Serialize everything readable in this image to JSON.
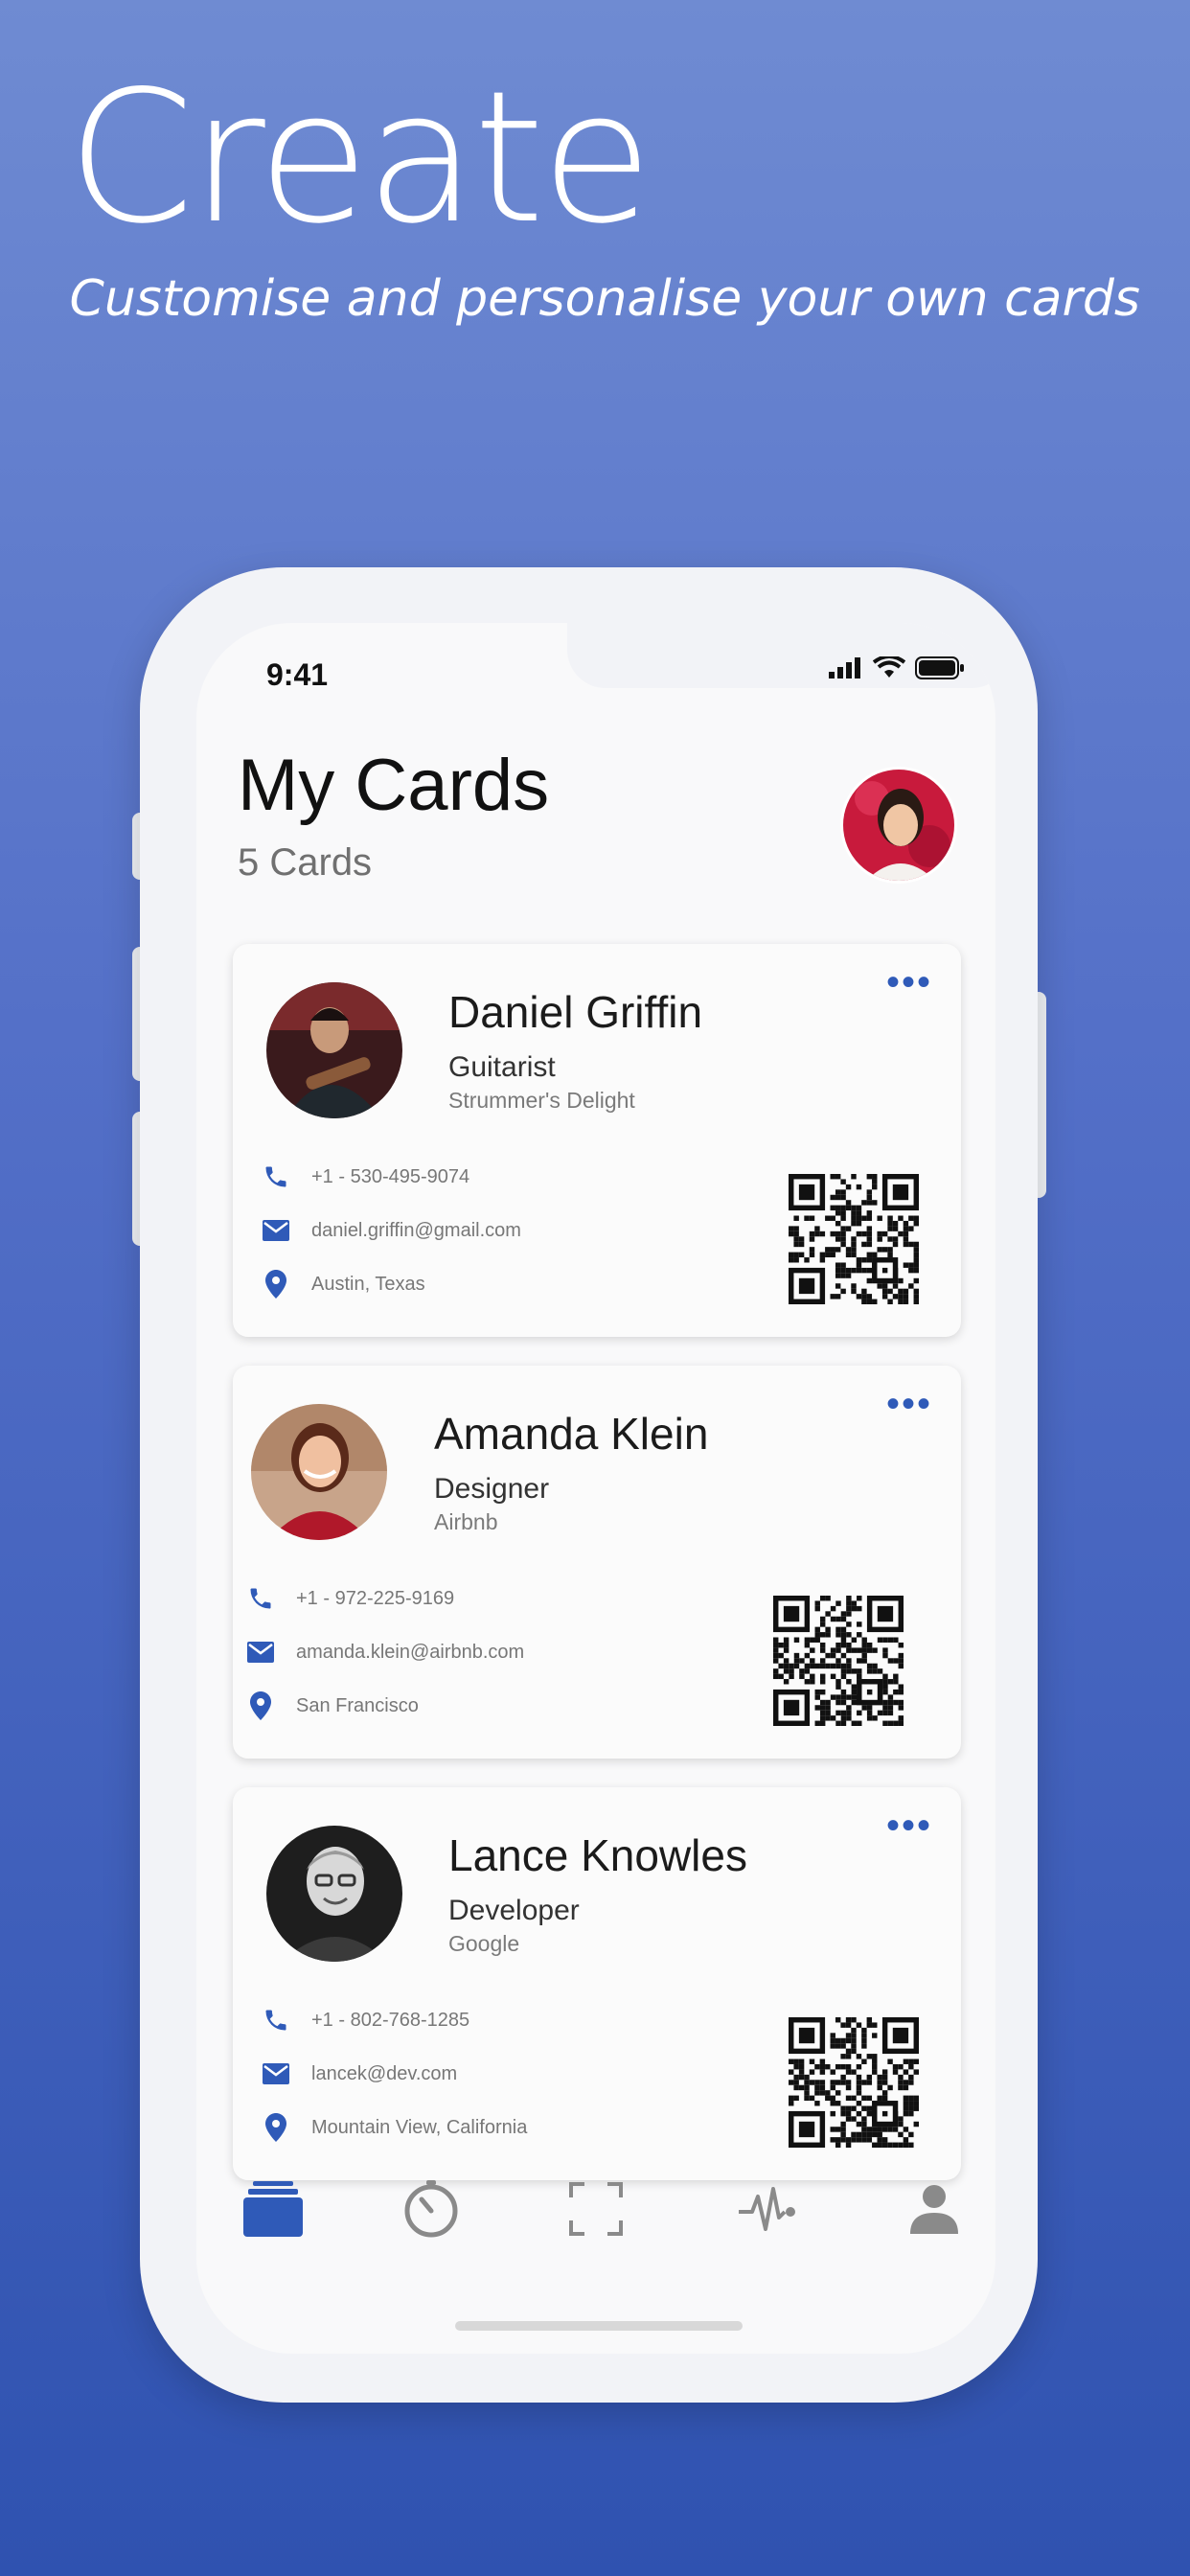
{
  "headline": "Create",
  "subheadline": "Customise and personalise your own cards",
  "status": {
    "time": "9:41"
  },
  "page": {
    "title": "My Cards",
    "count": "5 Cards"
  },
  "colors": {
    "accent": "#2f5ab8",
    "background_top": "#6f8bd2",
    "background_bottom": "#2f52b0"
  },
  "cards": [
    {
      "name": "Daniel Griffin",
      "role": "Guitarist",
      "company": "Strummer's Delight",
      "phone": "+1 - 530-495-9074",
      "email": "daniel.griffin@gmail.com",
      "location": "Austin, Texas"
    },
    {
      "name": "Amanda Klein",
      "role": "Designer",
      "company": "Airbnb",
      "phone": "+1 - 972-225-9169",
      "email": "amanda.klein@airbnb.com",
      "location": "San Francisco"
    },
    {
      "name": "Lance Knowles",
      "role": "Developer",
      "company": "Google",
      "phone": "+1 - 802-768-1285",
      "email": "lancek@dev.com",
      "location": "Mountain View, California"
    }
  ],
  "tabs": [
    {
      "icon": "cards-icon",
      "active": true
    },
    {
      "icon": "timer-icon",
      "active": false
    },
    {
      "icon": "scan-icon",
      "active": false
    },
    {
      "icon": "activity-icon",
      "active": false
    },
    {
      "icon": "profile-icon",
      "active": false
    }
  ]
}
